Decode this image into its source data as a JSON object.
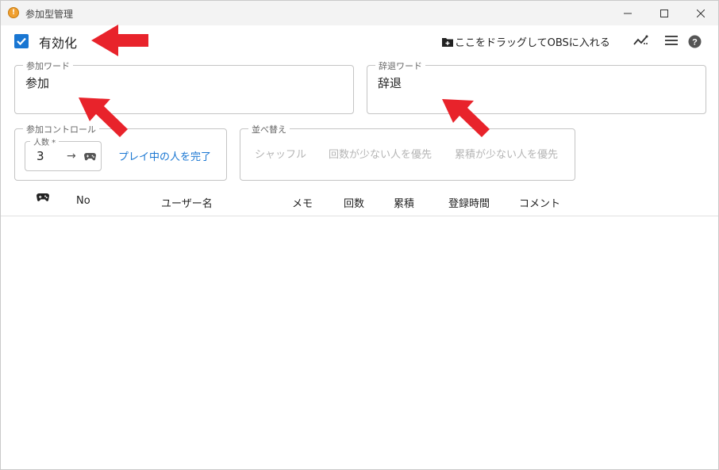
{
  "window": {
    "title": "参加型管理"
  },
  "toolbar": {
    "enable_label": "有効化",
    "enable_checked": true,
    "obs_drag_label": "ここをドラッグしてOBSに入れる"
  },
  "join_word": {
    "legend": "参加ワード",
    "value": "参加"
  },
  "leave_word": {
    "legend": "辞退ワード",
    "value": "辞退"
  },
  "join_control": {
    "legend": "参加コントロール",
    "count_legend": "人数 *",
    "count_value": "3",
    "finish_label": "プレイ中の人を完了"
  },
  "sort": {
    "legend": "並べ替え",
    "options": [
      "シャッフル",
      "回数が少ない人を優先",
      "累積が少ない人を優先"
    ]
  },
  "table": {
    "columns": [
      "No",
      "ユーザー名",
      "メモ",
      "回数",
      "累積",
      "登録時間",
      "コメント"
    ]
  },
  "colors": {
    "accent": "#1976d2",
    "annotation": "#e8232b"
  }
}
